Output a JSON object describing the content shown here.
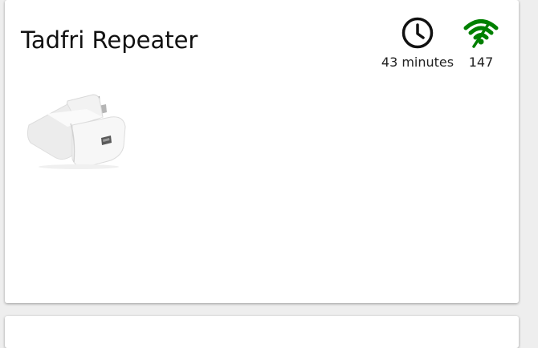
{
  "device": {
    "name": "Tadfri Repeater"
  },
  "last_seen": {
    "icon": "clock-icon",
    "value": "43 minutes"
  },
  "link_quality": {
    "icon": "signal-icon",
    "value": "147",
    "color": "#008000"
  }
}
